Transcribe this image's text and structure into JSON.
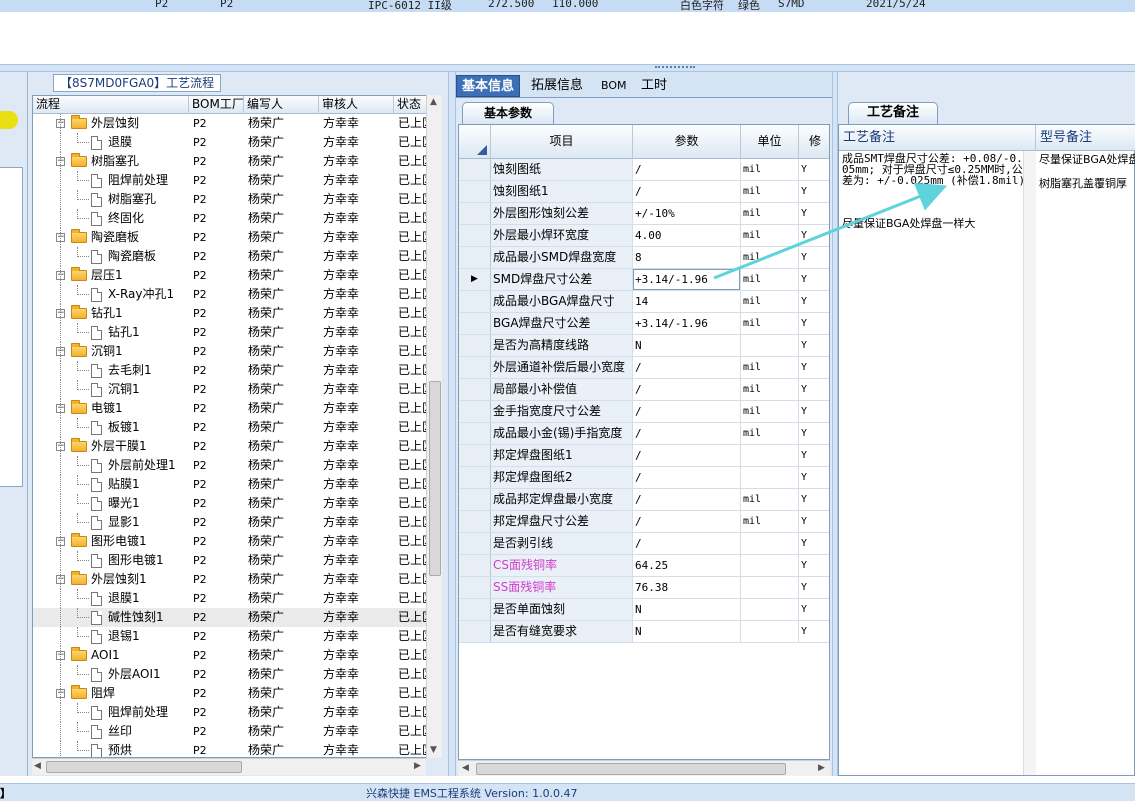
{
  "top_row": {
    "cells": [
      "P2",
      "P2",
      "IPC-6012 II级",
      "272.500",
      "110.000",
      "白色字符",
      "绿色",
      "S7MD",
      "2021/5/24"
    ]
  },
  "left_panel": {
    "title": "【8S7MD0FGA0】工艺流程",
    "columns": [
      "流程",
      "BOM工厂",
      "编写人",
      "审核人",
      "状态"
    ],
    "rows": [
      {
        "level": 0,
        "type": "folder",
        "name": "外层蚀刻",
        "bom": "P2",
        "writer": "杨荣广",
        "reviewer": "方幸幸",
        "status": "已上区"
      },
      {
        "level": 1,
        "type": "doc",
        "name": "退膜",
        "bom": "P2",
        "writer": "杨荣广",
        "reviewer": "方幸幸",
        "status": "已上区"
      },
      {
        "level": 0,
        "type": "folder",
        "name": "树脂塞孔",
        "bom": "P2",
        "writer": "杨荣广",
        "reviewer": "方幸幸",
        "status": "已上区"
      },
      {
        "level": 1,
        "type": "doc",
        "name": "阻焊前处理",
        "bom": "P2",
        "writer": "杨荣广",
        "reviewer": "方幸幸",
        "status": "已上区"
      },
      {
        "level": 1,
        "type": "doc",
        "name": "树脂塞孔",
        "bom": "P2",
        "writer": "杨荣广",
        "reviewer": "方幸幸",
        "status": "已上区"
      },
      {
        "level": 1,
        "type": "doc",
        "name": "终固化",
        "bom": "P2",
        "writer": "杨荣广",
        "reviewer": "方幸幸",
        "status": "已上区"
      },
      {
        "level": 0,
        "type": "folder",
        "name": "陶瓷磨板",
        "bom": "P2",
        "writer": "杨荣广",
        "reviewer": "方幸幸",
        "status": "已上区"
      },
      {
        "level": 1,
        "type": "doc",
        "name": "陶瓷磨板",
        "bom": "P2",
        "writer": "杨荣广",
        "reviewer": "方幸幸",
        "status": "已上区"
      },
      {
        "level": 0,
        "type": "folder",
        "name": "层压1",
        "bom": "P2",
        "writer": "杨荣广",
        "reviewer": "方幸幸",
        "status": "已上区"
      },
      {
        "level": 1,
        "type": "doc",
        "name": "X-Ray冲孔1",
        "bom": "P2",
        "writer": "杨荣广",
        "reviewer": "方幸幸",
        "status": "已上区"
      },
      {
        "level": 0,
        "type": "folder",
        "name": "钻孔1",
        "bom": "P2",
        "writer": "杨荣广",
        "reviewer": "方幸幸",
        "status": "已上区"
      },
      {
        "level": 1,
        "type": "doc",
        "name": "钻孔1",
        "bom": "P2",
        "writer": "杨荣广",
        "reviewer": "方幸幸",
        "status": "已上区"
      },
      {
        "level": 0,
        "type": "folder",
        "name": "沉铜1",
        "bom": "P2",
        "writer": "杨荣广",
        "reviewer": "方幸幸",
        "status": "已上区"
      },
      {
        "level": 1,
        "type": "doc",
        "name": "去毛刺1",
        "bom": "P2",
        "writer": "杨荣广",
        "reviewer": "方幸幸",
        "status": "已上区"
      },
      {
        "level": 1,
        "type": "doc",
        "name": "沉铜1",
        "bom": "P2",
        "writer": "杨荣广",
        "reviewer": "方幸幸",
        "status": "已上区"
      },
      {
        "level": 0,
        "type": "folder",
        "name": "电镀1",
        "bom": "P2",
        "writer": "杨荣广",
        "reviewer": "方幸幸",
        "status": "已上区"
      },
      {
        "level": 1,
        "type": "doc",
        "name": "板镀1",
        "bom": "P2",
        "writer": "杨荣广",
        "reviewer": "方幸幸",
        "status": "已上区"
      },
      {
        "level": 0,
        "type": "folder",
        "name": "外层干膜1",
        "bom": "P2",
        "writer": "杨荣广",
        "reviewer": "方幸幸",
        "status": "已上区"
      },
      {
        "level": 1,
        "type": "doc",
        "name": "外层前处理1",
        "bom": "P2",
        "writer": "杨荣广",
        "reviewer": "方幸幸",
        "status": "已上区"
      },
      {
        "level": 1,
        "type": "doc",
        "name": "贴膜1",
        "bom": "P2",
        "writer": "杨荣广",
        "reviewer": "方幸幸",
        "status": "已上区"
      },
      {
        "level": 1,
        "type": "doc",
        "name": "曝光1",
        "bom": "P2",
        "writer": "杨荣广",
        "reviewer": "方幸幸",
        "status": "已上区"
      },
      {
        "level": 1,
        "type": "doc",
        "name": "显影1",
        "bom": "P2",
        "writer": "杨荣广",
        "reviewer": "方幸幸",
        "status": "已上区"
      },
      {
        "level": 0,
        "type": "folder",
        "name": "图形电镀1",
        "bom": "P2",
        "writer": "杨荣广",
        "reviewer": "方幸幸",
        "status": "已上区"
      },
      {
        "level": 1,
        "type": "doc",
        "name": "图形电镀1",
        "bom": "P2",
        "writer": "杨荣广",
        "reviewer": "方幸幸",
        "status": "已上区"
      },
      {
        "level": 0,
        "type": "folder",
        "name": "外层蚀刻1",
        "bom": "P2",
        "writer": "杨荣广",
        "reviewer": "方幸幸",
        "status": "已上区"
      },
      {
        "level": 1,
        "type": "doc",
        "name": "退膜1",
        "bom": "P2",
        "writer": "杨荣广",
        "reviewer": "方幸幸",
        "status": "已上区"
      },
      {
        "level": 1,
        "type": "doc",
        "name": "碱性蚀刻1",
        "bom": "P2",
        "writer": "杨荣广",
        "reviewer": "方幸幸",
        "status": "已上区",
        "selected": true
      },
      {
        "level": 1,
        "type": "doc",
        "name": "退锡1",
        "bom": "P2",
        "writer": "杨荣广",
        "reviewer": "方幸幸",
        "status": "已上区"
      },
      {
        "level": 0,
        "type": "folder",
        "name": "AOI1",
        "bom": "P2",
        "writer": "杨荣广",
        "reviewer": "方幸幸",
        "status": "已上区"
      },
      {
        "level": 1,
        "type": "doc",
        "name": "外层AOI1",
        "bom": "P2",
        "writer": "杨荣广",
        "reviewer": "方幸幸",
        "status": "已上区"
      },
      {
        "level": 0,
        "type": "folder",
        "name": "阻焊",
        "bom": "P2",
        "writer": "杨荣广",
        "reviewer": "方幸幸",
        "status": "已上区"
      },
      {
        "level": 1,
        "type": "doc",
        "name": "阻焊前处理",
        "bom": "P2",
        "writer": "杨荣广",
        "reviewer": "方幸幸",
        "status": "已上区"
      },
      {
        "level": 1,
        "type": "doc",
        "name": "丝印",
        "bom": "P2",
        "writer": "杨荣广",
        "reviewer": "方幸幸",
        "status": "已上区"
      },
      {
        "level": 1,
        "type": "doc",
        "name": "预烘",
        "bom": "P2",
        "writer": "杨荣广",
        "reviewer": "方幸幸",
        "status": "已上区"
      }
    ]
  },
  "mid_panel": {
    "tabs": [
      "基本信息",
      "拓展信息",
      "BOM",
      "工时"
    ],
    "active_tab": 0,
    "subtab": "基本参数",
    "columns": [
      "项目",
      "参数",
      "单位",
      "修"
    ],
    "rows": [
      {
        "item": "蚀刻图纸",
        "value": "/",
        "unit": "mil",
        "mod": "Y"
      },
      {
        "item": "蚀刻图纸1",
        "value": "/",
        "unit": "mil",
        "mod": "Y"
      },
      {
        "item": "外层图形蚀刻公差",
        "value": "+/-10%",
        "unit": "mil",
        "mod": "Y"
      },
      {
        "item": "外层最小焊环宽度",
        "value": "4.00",
        "unit": "mil",
        "mod": "Y"
      },
      {
        "item": "成品最小SMD焊盘宽度",
        "value": "8",
        "unit": "mil",
        "mod": "Y"
      },
      {
        "item": "SMD焊盘尺寸公差",
        "value": "+3.14/-1.96",
        "unit": "mil",
        "mod": "Y",
        "current": true
      },
      {
        "item": "成品最小BGA焊盘尺寸",
        "value": "14",
        "unit": "mil",
        "mod": "Y"
      },
      {
        "item": "BGA焊盘尺寸公差",
        "value": "+3.14/-1.96",
        "unit": "mil",
        "mod": "Y"
      },
      {
        "item": "是否为高精度线路",
        "value": "N",
        "unit": "",
        "mod": "Y"
      },
      {
        "item": "外层通道补偿后最小宽度",
        "value": "/",
        "unit": "mil",
        "mod": "Y"
      },
      {
        "item": "局部最小补偿值",
        "value": "/",
        "unit": "mil",
        "mod": "Y"
      },
      {
        "item": "金手指宽度尺寸公差",
        "value": "/",
        "unit": "mil",
        "mod": "Y"
      },
      {
        "item": "成品最小金(锡)手指宽度",
        "value": "/",
        "unit": "mil",
        "mod": "Y"
      },
      {
        "item": "邦定焊盘图纸1",
        "value": "/",
        "unit": "",
        "mod": "Y"
      },
      {
        "item": "邦定焊盘图纸2",
        "value": "/",
        "unit": "",
        "mod": "Y"
      },
      {
        "item": "成品邦定焊盘最小宽度",
        "value": "/",
        "unit": "mil",
        "mod": "Y"
      },
      {
        "item": "邦定焊盘尺寸公差",
        "value": "/",
        "unit": "mil",
        "mod": "Y"
      },
      {
        "item": "是否剥引线",
        "value": "/",
        "unit": "",
        "mod": "Y"
      },
      {
        "item": "CS面残铜率",
        "value": "64.25",
        "unit": "",
        "mod": "Y",
        "pink": true
      },
      {
        "item": "SS面残铜率",
        "value": "76.38",
        "unit": "",
        "mod": "Y",
        "pink": true
      },
      {
        "item": "是否单面蚀刻",
        "value": "N",
        "unit": "",
        "mod": "Y"
      },
      {
        "item": "是否有缝宽要求",
        "value": "N",
        "unit": "",
        "mod": "Y"
      }
    ]
  },
  "right_panel": {
    "tab": "工艺备注",
    "col1": "工艺备注",
    "col2": "型号备注",
    "note_text": "成品SMT焊盘尺寸公差: +0.08/-0.05mm; 对于焊盘尺寸≤0.25MM时,公差为: +/-0.025mm (补偿1.8mil)",
    "note_text2": "尽量保证BGA处焊盘一样大",
    "model_notes": [
      "尽量保证BGA处焊盘",
      "树脂塞孔盖覆铜厚"
    ]
  },
  "status_bar": {
    "left_mark": "】",
    "text": "兴森快捷 EMS工程系统 Version: 1.0.0.47"
  },
  "colors": {
    "accent": "#3d6fb6",
    "pink_text": "#d23cc8",
    "arrow": "#5fd3dc"
  }
}
